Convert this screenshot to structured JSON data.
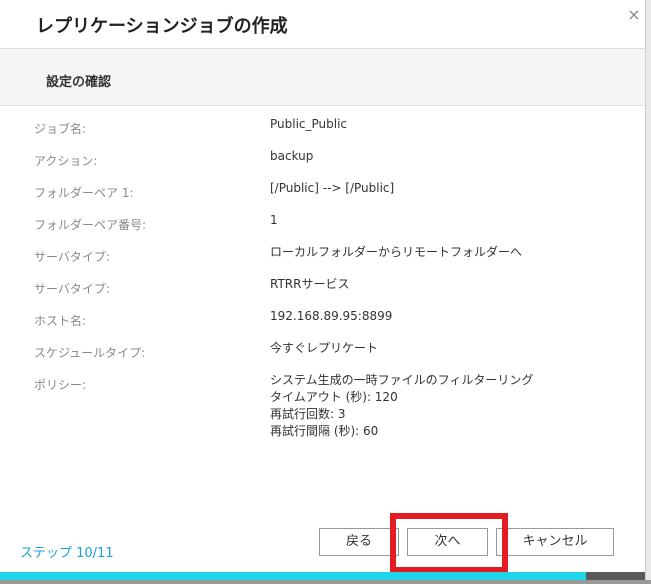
{
  "dialog": {
    "title": "レプリケーションジョブの作成",
    "close_glyph": "×",
    "section_title": "設定の確認"
  },
  "details": [
    {
      "label": "ジョブ名:",
      "value": [
        "Public_Public"
      ]
    },
    {
      "label": "アクション:",
      "value": [
        "backup"
      ]
    },
    {
      "label": "フォルダーペア 1:",
      "value": [
        "[/Public] --> [/Public]"
      ]
    },
    {
      "label": "フォルダーペア番号:",
      "value": [
        "1"
      ]
    },
    {
      "label": "サーバタイプ:",
      "value": [
        "ローカルフォルダーからリモートフォルダーへ"
      ]
    },
    {
      "label": "サーバタイプ:",
      "value": [
        "RTRRサービス"
      ]
    },
    {
      "label": "ホスト名:",
      "value": [
        "192.168.89.95:8899"
      ]
    },
    {
      "label": "スケジュールタイプ:",
      "value": [
        "今すぐレプリケート"
      ]
    },
    {
      "label": "ポリシー:",
      "value": [
        "システム生成の一時ファイルのフィルターリング",
        "タイムアウト (秒): 120",
        "再試行回数: 3",
        "再試行間隔 (秒): 60"
      ]
    }
  ],
  "footer": {
    "step": "ステップ 10/11",
    "back_label": "戻る",
    "next_label": "次へ",
    "cancel_label": "キャンセル",
    "progress_fraction": 0.909
  },
  "colors": {
    "accent": "#1aa1d7",
    "progress": "#1ed4e8",
    "highlight": "#e31b23"
  }
}
